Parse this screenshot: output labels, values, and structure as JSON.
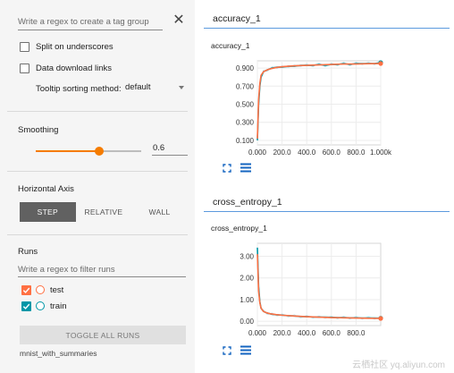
{
  "sidebar": {
    "tag_regex_placeholder": "Write a regex to create a tag group",
    "close_glyph": "✕",
    "split_underscores_label": "Split on underscores",
    "data_download_label": "Data download links",
    "tooltip_sort_label": "Tooltip sorting method:",
    "tooltip_sort_value": "default",
    "smoothing": {
      "title": "Smoothing",
      "value": "0.6",
      "fraction": 0.6
    },
    "horizontal_axis": {
      "title": "Horizontal Axis",
      "options": [
        "STEP",
        "RELATIVE",
        "WALL"
      ],
      "selected": "STEP"
    },
    "runs": {
      "title": "Runs",
      "filter_placeholder": "Write a regex to filter runs",
      "items": [
        {
          "name": "test",
          "color": "#ff7043",
          "checked": true
        },
        {
          "name": "train",
          "color": "#0097a7",
          "checked": true
        }
      ],
      "toggle_all_label": "TOGGLE ALL RUNS",
      "footer_dir": "mnist_with_summaries"
    }
  },
  "main": {
    "sections": [
      {
        "name": "accuracy_1",
        "chart_title": "accuracy_1"
      },
      {
        "name": "cross_entropy_1",
        "chart_title": "cross_entropy_1"
      }
    ],
    "watermark": "云栖社区 yq.aliyun.com"
  },
  "colors": {
    "test": "#ff7043",
    "train": "#0097a7",
    "train_raw": "#9fd9e6",
    "accent": "#f57c00",
    "section_border": "#5c9ade"
  },
  "chart_data": [
    {
      "type": "line",
      "title": "accuracy_1",
      "x_ticks": [
        "0.000",
        "200.0",
        "400.0",
        "600.0",
        "800.0",
        "1.000k"
      ],
      "y_ticks": [
        "0.100",
        "0.300",
        "0.500",
        "0.700",
        "0.900"
      ],
      "xlim": [
        0,
        1000
      ],
      "ylim": [
        0.05,
        0.98
      ],
      "grid": true,
      "series": [
        {
          "name": "train",
          "x": [
            0,
            10,
            20,
            30,
            50,
            80,
            120,
            160,
            200,
            250,
            300,
            350,
            400,
            450,
            500,
            550,
            600,
            650,
            700,
            750,
            800,
            850,
            900,
            950,
            1000
          ],
          "y": [
            0.1,
            0.5,
            0.7,
            0.8,
            0.86,
            0.88,
            0.9,
            0.91,
            0.91,
            0.92,
            0.92,
            0.93,
            0.93,
            0.93,
            0.94,
            0.93,
            0.94,
            0.94,
            0.95,
            0.94,
            0.95,
            0.95,
            0.95,
            0.95,
            0.96
          ]
        },
        {
          "name": "test",
          "x": [
            0,
            10,
            20,
            30,
            50,
            80,
            100,
            150,
            200,
            300,
            400,
            500,
            600,
            700,
            800,
            900,
            1000
          ],
          "y": [
            0.12,
            0.55,
            0.73,
            0.82,
            0.86,
            0.88,
            0.89,
            0.905,
            0.915,
            0.925,
            0.93,
            0.935,
            0.94,
            0.945,
            0.945,
            0.948,
            0.95
          ]
        }
      ]
    },
    {
      "type": "line",
      "title": "cross_entropy_1",
      "x_ticks": [
        "0.000",
        "200.0",
        "400.0",
        "600.0",
        "800.0"
      ],
      "y_ticks": [
        "0.00",
        "1.00",
        "2.00",
        "3.00"
      ],
      "xlim": [
        0,
        1000
      ],
      "ylim": [
        -0.2,
        3.6
      ],
      "grid": true,
      "series": [
        {
          "name": "train",
          "x": [
            0,
            10,
            20,
            30,
            50,
            80,
            120,
            160,
            200,
            250,
            300,
            350,
            400,
            450,
            500,
            550,
            600,
            650,
            700,
            750,
            800,
            850,
            900,
            950,
            1000
          ],
          "y": [
            3.4,
            1.6,
            0.9,
            0.6,
            0.45,
            0.38,
            0.32,
            0.3,
            0.28,
            0.26,
            0.24,
            0.22,
            0.21,
            0.2,
            0.19,
            0.19,
            0.18,
            0.17,
            0.17,
            0.16,
            0.16,
            0.15,
            0.15,
            0.15,
            0.14
          ]
        },
        {
          "name": "test",
          "x": [
            0,
            10,
            20,
            30,
            50,
            80,
            100,
            150,
            200,
            300,
            400,
            500,
            600,
            700,
            800,
            900,
            1000
          ],
          "y": [
            3.1,
            1.4,
            0.85,
            0.6,
            0.45,
            0.38,
            0.35,
            0.31,
            0.28,
            0.24,
            0.21,
            0.19,
            0.17,
            0.16,
            0.15,
            0.14,
            0.13
          ]
        }
      ]
    }
  ]
}
